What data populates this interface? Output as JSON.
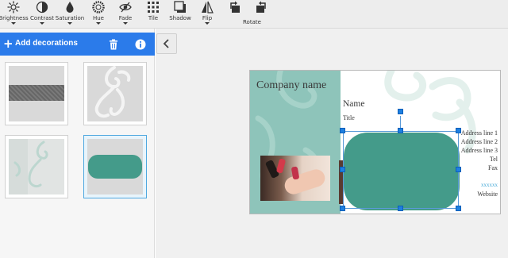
{
  "toolbar": {
    "tools": [
      {
        "label": "Brightness",
        "icon": "brightness-icon"
      },
      {
        "label": "Contrast",
        "icon": "contrast-icon"
      },
      {
        "label": "Saturation",
        "icon": "saturation-icon"
      },
      {
        "label": "Hue",
        "icon": "hue-icon"
      },
      {
        "label": "Fade",
        "icon": "fade-icon"
      },
      {
        "label": "Tile",
        "icon": "tile-icon"
      },
      {
        "label": "Shadow",
        "icon": "shadow-icon"
      },
      {
        "label": "Flip",
        "icon": "flip-icon"
      },
      {
        "label": "Rotate",
        "icon": "rotate-icon"
      }
    ]
  },
  "panel": {
    "title": "Add decorations",
    "accent": "#2b7bea"
  },
  "decorations": [
    {
      "name": "gray-band",
      "selected": false
    },
    {
      "name": "swirl-white",
      "selected": false
    },
    {
      "name": "swirl-teal-faint",
      "selected": false
    },
    {
      "name": "rounded-teal-rectangle",
      "selected": true
    }
  ],
  "card": {
    "company": "Company name",
    "name": "Name",
    "title": "Title",
    "address_lines": [
      "Address line 1",
      "Address line 2",
      "Address line 3"
    ],
    "tel": "Tel",
    "fax": "Fax",
    "email": "xxxxxx",
    "website": "Website",
    "teal": "#449b8a",
    "panel_color": "#8ec4ba"
  }
}
